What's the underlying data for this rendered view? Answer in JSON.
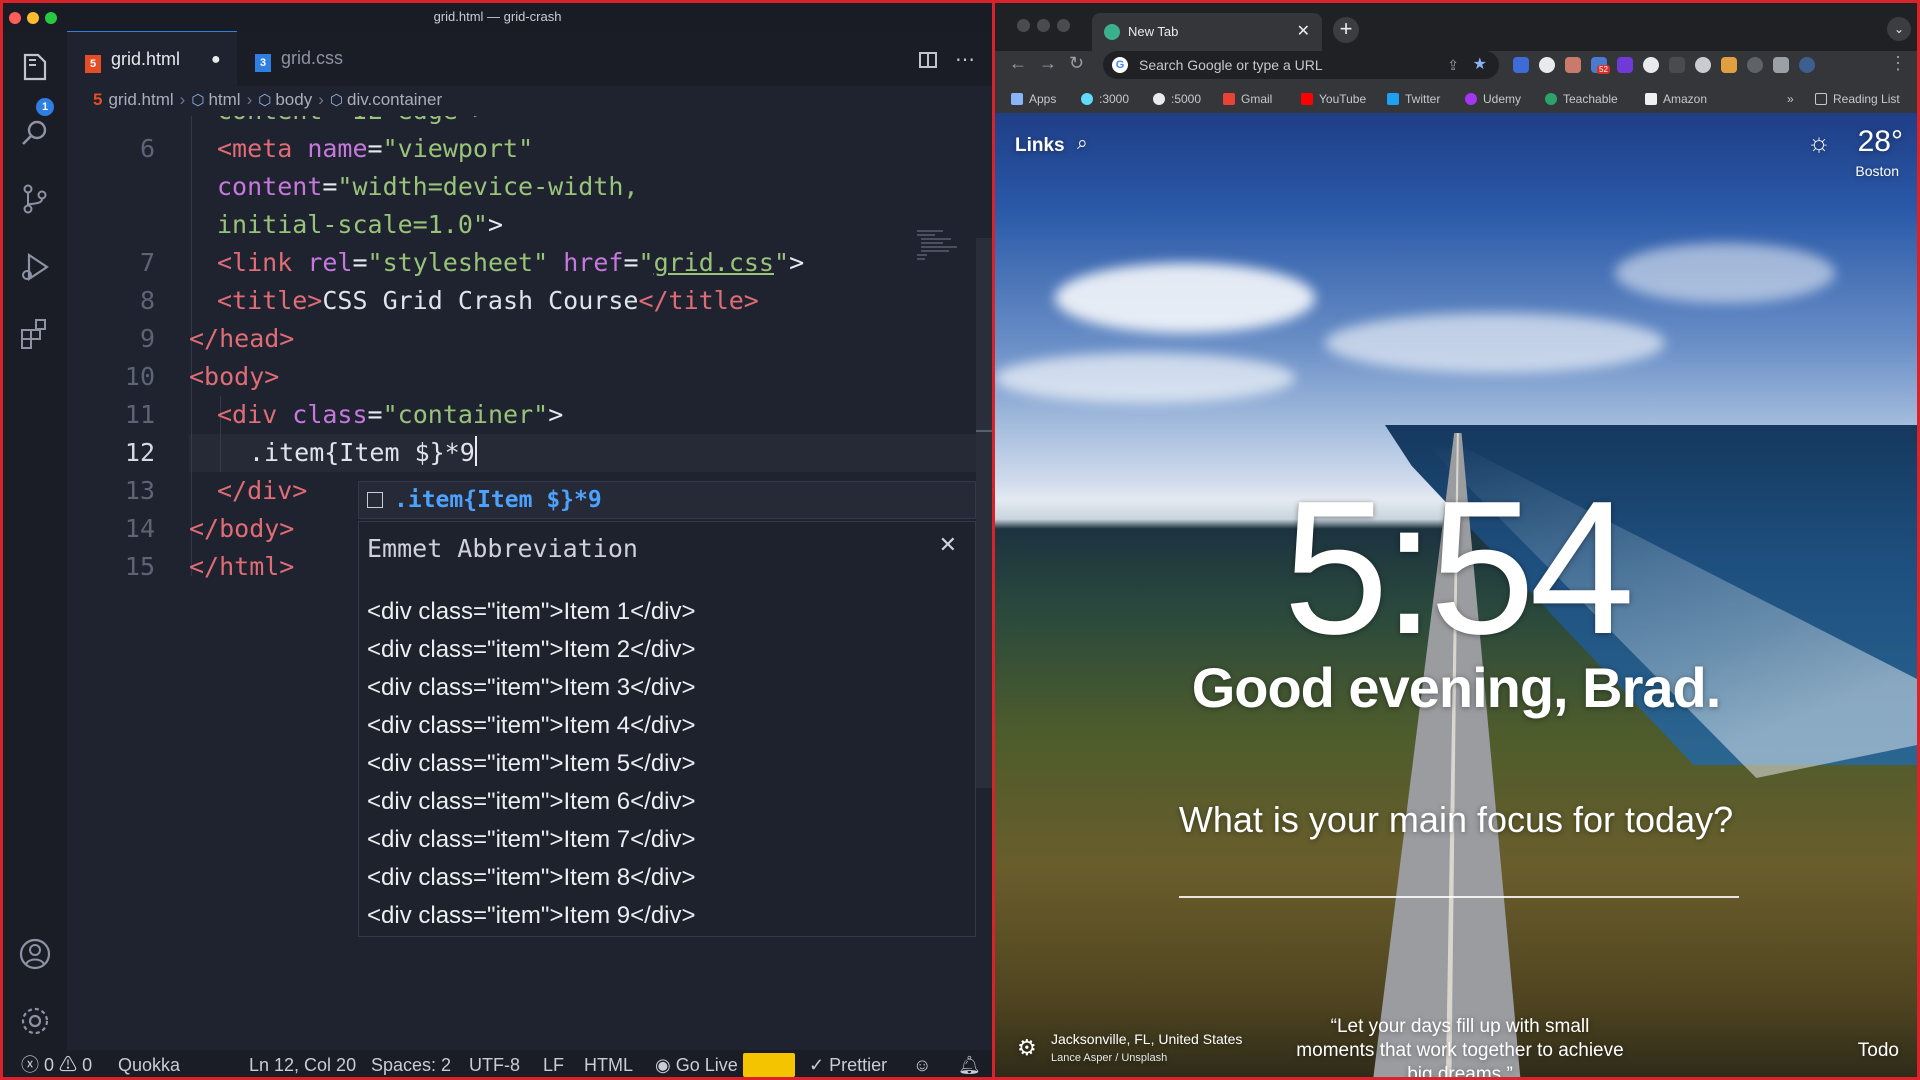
{
  "vscode": {
    "window_title": "grid.html — grid-crash",
    "explorer_badge": "1",
    "tabs": [
      {
        "label": "grid.html",
        "icon": "html5-icon",
        "modified": true
      },
      {
        "label": "grid.css",
        "icon": "css3-icon",
        "modified": false
      }
    ],
    "breadcrumb": [
      "grid.html",
      "html",
      "body",
      "div.container"
    ],
    "lines": [
      {
        "num": "",
        "text": "content=\"IE=edge\">"
      },
      {
        "num": "6",
        "text": "<meta name=\"viewport\""
      },
      {
        "num": "",
        "text": "content=\"width=device-width,"
      },
      {
        "num": "",
        "text": "initial-scale=1.0\">"
      },
      {
        "num": "7",
        "text": "<link rel=\"stylesheet\" href=\"grid.css\">"
      },
      {
        "num": "8",
        "text": "<title>CSS Grid Crash Course</title>"
      },
      {
        "num": "9",
        "text": "</head>"
      },
      {
        "num": "10",
        "text": "<body>"
      },
      {
        "num": "11",
        "text": "<div class=\"container\">"
      },
      {
        "num": "12",
        "text": ".item{Item $}*9"
      },
      {
        "num": "13",
        "text": "</div>"
      },
      {
        "num": "14",
        "text": "</body>"
      },
      {
        "num": "15",
        "text": "</html>"
      }
    ],
    "suggestion": ".item{Item $}*9",
    "emmet": {
      "title": "Emmet Abbreviation",
      "items": [
        "<div class=\"item\">Item 1</div>",
        "<div class=\"item\">Item 2</div>",
        "<div class=\"item\">Item 3</div>",
        "<div class=\"item\">Item 4</div>",
        "<div class=\"item\">Item 5</div>",
        "<div class=\"item\">Item 6</div>",
        "<div class=\"item\">Item 7</div>",
        "<div class=\"item\">Item 8</div>",
        "<div class=\"item\">Item 9</div>"
      ]
    },
    "status": {
      "errors": "0",
      "warnings": "0",
      "quokka": "Quokka",
      "position": "Ln 12, Col 20",
      "spaces": "Spaces: 2",
      "encoding": "UTF-8",
      "eol": "LF",
      "language": "HTML",
      "golive": "Go Live",
      "prettier": "Prettier"
    }
  },
  "chrome": {
    "tab_title": "New Tab",
    "omnibox_placeholder": "Search Google or type a URL",
    "bookmarks": [
      "Apps",
      ":3000",
      ":5000",
      "Gmail",
      "YouTube",
      "Twitter",
      "Udemy",
      "Teachable",
      "Amazon"
    ],
    "reading_list": "Reading List",
    "extension_badge": "52"
  },
  "newtab": {
    "links": "Links",
    "temperature": "28°",
    "city": "Boston",
    "time": "5:54",
    "greeting": "Good evening, Brad.",
    "focus_question": "What is your main focus for today?",
    "location": "Jacksonville, FL, United States",
    "photo_credit": "Lance Asper / Unsplash",
    "quote": "“Let your days fill up with small moments that work together to achieve big dreams.”",
    "todo": "Todo"
  },
  "colors": {
    "accent_red_border": "#d9232b",
    "editor_bg": "#1f2330",
    "suggest_blue": "#4ea2ff",
    "status_yellow": "#f5c400"
  }
}
